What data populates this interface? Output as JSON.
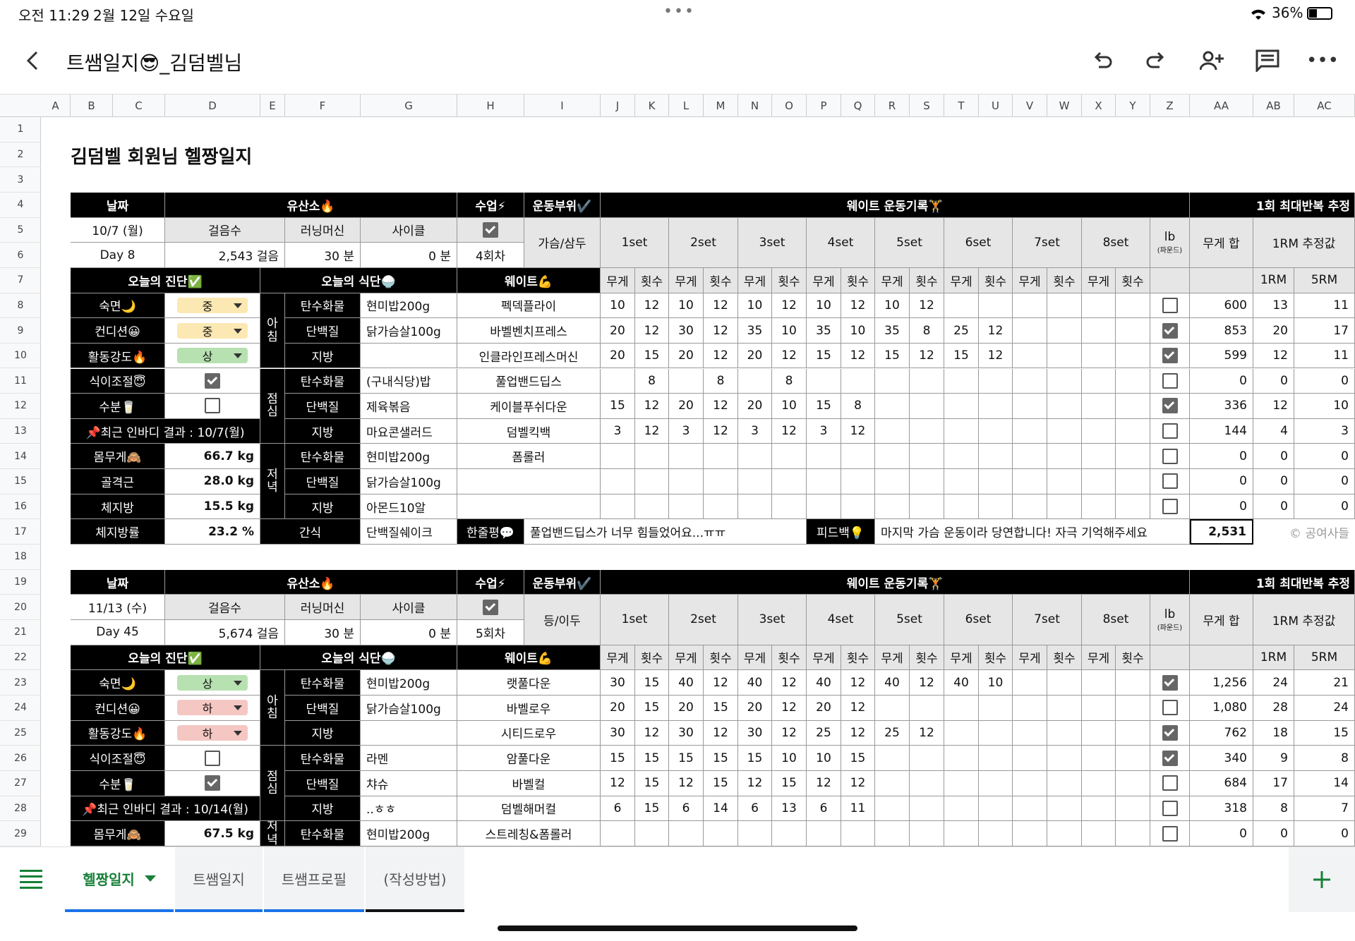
{
  "status": {
    "time": "오전 11:29",
    "date": "2월 12일 수요일",
    "battery": "36%"
  },
  "doc_title": "트쌤일지😎_김덤벨님",
  "columns": [
    "A",
    "B",
    "C",
    "D",
    "E",
    "F",
    "G",
    "H",
    "I",
    "J",
    "K",
    "L",
    "M",
    "N",
    "O",
    "P",
    "Q",
    "R",
    "S",
    "T",
    "U",
    "V",
    "W",
    "X",
    "Y",
    "Z",
    "AA",
    "AB",
    "AC"
  ],
  "rows": [
    "1",
    "2",
    "3",
    "4",
    "5",
    "6",
    "7",
    "8",
    "9",
    "10",
    "11",
    "12",
    "13",
    "14",
    "15",
    "16",
    "17",
    "18",
    "19",
    "20",
    "21",
    "22",
    "23",
    "24",
    "25",
    "26",
    "27",
    "28",
    "29"
  ],
  "sheet_title": "김덤벨 회원님 헬짱일지",
  "headers": {
    "date": "날짜",
    "cardio": "유산소🔥",
    "class": "수업⚡",
    "part": "운동부위✔️",
    "weight_log": "웨이트 운동기록🏋",
    "onerm_header": "1회 최대반복 추정",
    "steps": "걸음수",
    "treadmill": "러닝머신",
    "cycle": "사이클",
    "sets": [
      "1set",
      "2set",
      "3set",
      "4set",
      "5set",
      "6set",
      "7set",
      "8set"
    ],
    "lb": "lb",
    "lb_sub": "(파운드)",
    "sum": "무게 합",
    "onerm_est": "1RM 추정값",
    "w": "무게",
    "r": "횟수",
    "onerm": "1RM",
    "fiverm": "5RM",
    "twelve": "12",
    "diag": "오늘의 진단✅",
    "diet": "오늘의 식단🍚",
    "weight": "웨이트💪",
    "carb": "탄수화물",
    "protein": "단백질",
    "fat": "지방",
    "breakfast": "아\n침",
    "lunch": "점\n심",
    "dinner": "저\n녁",
    "snack": "간식",
    "sleep": "숙면🌙",
    "condition": "컨디션😀",
    "intensity": "활동강도🔥",
    "diet_ctrl": "식이조절😇",
    "water": "수분🥛",
    "body_weight": "몸무게🙈",
    "muscle": "골격근",
    "body_fat": "체지방",
    "fat_pct": "체지방률",
    "review": "한줄평💬",
    "feedback": "피드백💡",
    "copyright": "© 공여사들"
  },
  "block1": {
    "date": "10/7 (월)",
    "day": "Day 8",
    "steps": "2,543 걸음",
    "treadmill": "30 분",
    "cycle": "0 분",
    "class_checked": true,
    "class_count": "4회차",
    "part": "가슴/삼두",
    "sleep": "중",
    "condition": "중",
    "intensity": "상",
    "diet_ctrl": true,
    "water": false,
    "inbody": "📌최근 인바디 결과 : 10/7(월)",
    "body_weight": "66.7 kg",
    "muscle": "28.0 kg",
    "body_fat": "15.5 kg",
    "fat_pct": "23.2 %",
    "meals": {
      "b_carb": "현미밥200g",
      "b_protein": "닭가슴살100g",
      "b_fat": "",
      "l_carb": "(구내식당)밥",
      "l_protein": "제육볶음",
      "l_fat": "마요콘샐러드",
      "d_carb": "현미밥200g",
      "d_protein": "닭가슴살100g",
      "d_fat": "아몬드10알",
      "snack": "단백질쉐이크"
    },
    "review": "풀업밴드딥스가 너무 힘들었어요...ㅠㅠ",
    "feedback": "마지막 가슴 운동이라 당연합니다! 자극 기억해주세요",
    "total": "2,531",
    "exercises": [
      {
        "name": "펙덱플라이",
        "sets": [
          "10",
          "12",
          "10",
          "12",
          "10",
          "12",
          "10",
          "12",
          "10",
          "12",
          "",
          "",
          "",
          "",
          "",
          ""
        ],
        "lb": false,
        "sum": "600",
        "rm1": "13",
        "rm5": "11"
      },
      {
        "name": "바벨벤치프레스",
        "sets": [
          "20",
          "12",
          "30",
          "12",
          "35",
          "10",
          "35",
          "10",
          "35",
          "8",
          "25",
          "12",
          "",
          "",
          "",
          ""
        ],
        "lb": true,
        "sum": "853",
        "rm1": "20",
        "rm5": "17"
      },
      {
        "name": "인클라인프레스머신",
        "sets": [
          "20",
          "15",
          "20",
          "12",
          "20",
          "12",
          "15",
          "12",
          "15",
          "12",
          "15",
          "12",
          "",
          "",
          "",
          ""
        ],
        "lb": true,
        "sum": "599",
        "rm1": "12",
        "rm5": "11"
      },
      {
        "name": "풀업밴드딥스",
        "sets": [
          "",
          "8",
          "",
          "8",
          "",
          "8",
          "",
          "",
          "",
          "",
          "",
          "",
          "",
          "",
          "",
          ""
        ],
        "lb": false,
        "sum": "0",
        "rm1": "0",
        "rm5": "0"
      },
      {
        "name": "케이블푸쉬다운",
        "sets": [
          "15",
          "12",
          "20",
          "12",
          "20",
          "10",
          "15",
          "8",
          "",
          "",
          "",
          "",
          "",
          "",
          "",
          ""
        ],
        "lb": true,
        "sum": "336",
        "rm1": "12",
        "rm5": "10"
      },
      {
        "name": "덤벨킥백",
        "sets": [
          "3",
          "12",
          "3",
          "12",
          "3",
          "12",
          "3",
          "12",
          "",
          "",
          "",
          "",
          "",
          "",
          "",
          ""
        ],
        "lb": false,
        "sum": "144",
        "rm1": "4",
        "rm5": "3"
      },
      {
        "name": "폼롤러",
        "sets": [
          "",
          "",
          "",
          "",
          "",
          "",
          "",
          "",
          "",
          "",
          "",
          "",
          "",
          "",
          "",
          ""
        ],
        "lb": false,
        "sum": "0",
        "rm1": "0",
        "rm5": "0"
      },
      {
        "name": "",
        "sets": [
          "",
          "",
          "",
          "",
          "",
          "",
          "",
          "",
          "",
          "",
          "",
          "",
          "",
          "",
          "",
          ""
        ],
        "lb": false,
        "sum": "0",
        "rm1": "0",
        "rm5": "0"
      },
      {
        "name": "",
        "sets": [
          "",
          "",
          "",
          "",
          "",
          "",
          "",
          "",
          "",
          "",
          "",
          "",
          "",
          "",
          "",
          ""
        ],
        "lb": false,
        "sum": "0",
        "rm1": "0",
        "rm5": "0"
      }
    ]
  },
  "block2": {
    "date": "11/13 (수)",
    "day": "Day 45",
    "steps": "5,674 걸음",
    "treadmill": "30 분",
    "cycle": "0 분",
    "class_checked": true,
    "class_count": "5회차",
    "part": "등/이두",
    "sleep": "상",
    "condition": "하",
    "intensity": "하",
    "diet_ctrl": false,
    "water": true,
    "inbody": "📌최근 인바디 결과 : 10/14(월)",
    "body_weight": "67.5 kg",
    "meals": {
      "b_carb": "현미밥200g",
      "b_protein": "닭가슴살100g",
      "b_fat": "",
      "l_carb": "라멘",
      "l_protein": "챠슈",
      "l_fat": "..ㅎㅎ",
      "d_carb": "현미밥200g"
    },
    "exercises": [
      {
        "name": "랫풀다운",
        "sets": [
          "30",
          "15",
          "40",
          "12",
          "40",
          "12",
          "40",
          "12",
          "40",
          "12",
          "40",
          "10",
          "",
          "",
          "",
          ""
        ],
        "lb": true,
        "sum": "1,256",
        "rm1": "24",
        "rm5": "21"
      },
      {
        "name": "바벨로우",
        "sets": [
          "20",
          "15",
          "20",
          "15",
          "20",
          "12",
          "20",
          "12",
          "",
          "",
          "",
          "",
          "",
          "",
          "",
          ""
        ],
        "lb": false,
        "sum": "1,080",
        "rm1": "28",
        "rm5": "24"
      },
      {
        "name": "시티드로우",
        "sets": [
          "30",
          "12",
          "30",
          "12",
          "30",
          "12",
          "25",
          "12",
          "25",
          "12",
          "",
          "",
          "",
          "",
          "",
          ""
        ],
        "lb": true,
        "sum": "762",
        "rm1": "18",
        "rm5": "15"
      },
      {
        "name": "암풀다운",
        "sets": [
          "15",
          "15",
          "15",
          "15",
          "15",
          "10",
          "10",
          "15",
          "",
          "",
          "",
          "",
          "",
          "",
          "",
          ""
        ],
        "lb": true,
        "sum": "340",
        "rm1": "9",
        "rm5": "8"
      },
      {
        "name": "바벨컬",
        "sets": [
          "12",
          "15",
          "12",
          "15",
          "12",
          "15",
          "12",
          "12",
          "",
          "",
          "",
          "",
          "",
          "",
          "",
          ""
        ],
        "lb": false,
        "sum": "684",
        "rm1": "17",
        "rm5": "14"
      },
      {
        "name": "덤벨해머컬",
        "sets": [
          "6",
          "15",
          "6",
          "14",
          "6",
          "13",
          "6",
          "11",
          "",
          "",
          "",
          "",
          "",
          "",
          "",
          ""
        ],
        "lb": false,
        "sum": "318",
        "rm1": "8",
        "rm5": "7"
      },
      {
        "name": "스트레칭&폼롤러",
        "sets": [
          "",
          "",
          "",
          "",
          "",
          "",
          "",
          "",
          "",
          "",
          "",
          "",
          "",
          "",
          "",
          ""
        ],
        "lb": false,
        "sum": "0",
        "rm1": "0",
        "rm5": "0"
      }
    ]
  },
  "tabs": [
    "헬짱일지",
    "트쌤일지",
    "트쌤프로필",
    "(작성방법)"
  ],
  "colors": {
    "accent": "#1a73e8",
    "green": "#188038",
    "mid_pill": "#fce8b2",
    "high_pill": "#b7e1b0",
    "low_pill": "#f4c7c3"
  }
}
